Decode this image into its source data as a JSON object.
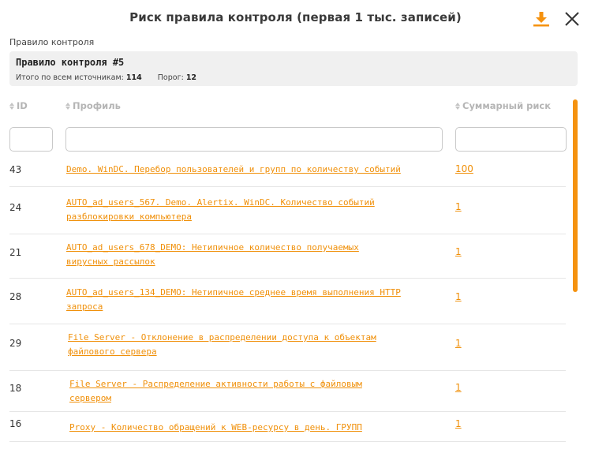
{
  "header": {
    "title": "Риск правила контроля (первая  1 тыс. записей)",
    "download_icon": "download-icon",
    "close_icon": "close-icon"
  },
  "rule": {
    "label": "Правило контроля",
    "name": "Правило контроля #5",
    "total_label": "Итого по всем источникам:",
    "total_value": "114",
    "threshold_label": "Порог:",
    "threshold_value": "12"
  },
  "table": {
    "columns": {
      "id": "ID",
      "profile": "Профиль",
      "risk": "Суммарный риск"
    },
    "filters": {
      "id": "",
      "profile": "",
      "risk": ""
    },
    "rows": [
      {
        "id": "43",
        "profile": "Demo. WinDC. Перебор пользователей и групп по количеству событий",
        "risk": "100"
      },
      {
        "id": "24",
        "profile": "AUTO_ad_users_567. Demo. Alertix. WinDC. Количество событий разблокировки компьютера",
        "risk": "1"
      },
      {
        "id": "21",
        "profile": "AUTO_ad_users_678_DEMO: Нетипичное количество получаемых вирусных рассылок",
        "risk": "1"
      },
      {
        "id": "28",
        "profile": "AUTO_ad_users_134_DEMO: Нетипичное среднее время выполнения HTTP запроса",
        "risk": "1"
      },
      {
        "id": "29",
        "profile": "File Server - Отклонение в распределении доступа к объектам файлового сервера",
        "risk": "1"
      },
      {
        "id": "18",
        "profile": "File Server - Распределение активности работы с файловым сервером",
        "risk": "1"
      },
      {
        "id": "16",
        "profile": "Proxy - Количество обращений к WEB-ресурсу в день. ГРУПП",
        "risk": "1"
      }
    ]
  },
  "colors": {
    "accent": "#f0900a",
    "header_text": "#b5b5b5"
  }
}
